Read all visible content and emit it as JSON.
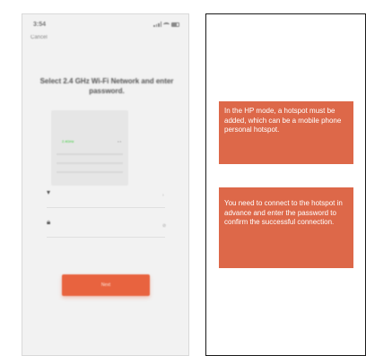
{
  "phone": {
    "status_bar": {
      "time": "3:54"
    },
    "cancel_label": "Cancel",
    "heading": "Select 2.4 GHz Wi-Fi Network and enter password.",
    "subtext": "",
    "network_list": {
      "header": "",
      "selected_network": "",
      "selected_frequency": "2.4GHz",
      "dots": "• •"
    },
    "wifi_field": {
      "placeholder": "",
      "icon": "wifi-icon"
    },
    "password_field": {
      "placeholder": "",
      "icon": "lock-icon"
    },
    "next_label": "Next",
    "accent": "#e8633f"
  },
  "callouts": [
    {
      "text": "In the HP mode, a hotspot must be added, which can be a mobile phone personal hotspot."
    },
    {
      "text": "You need to connect to the hotspot in advance and enter the password to confirm the successful connection."
    }
  ],
  "callout_color": "#dd6849"
}
